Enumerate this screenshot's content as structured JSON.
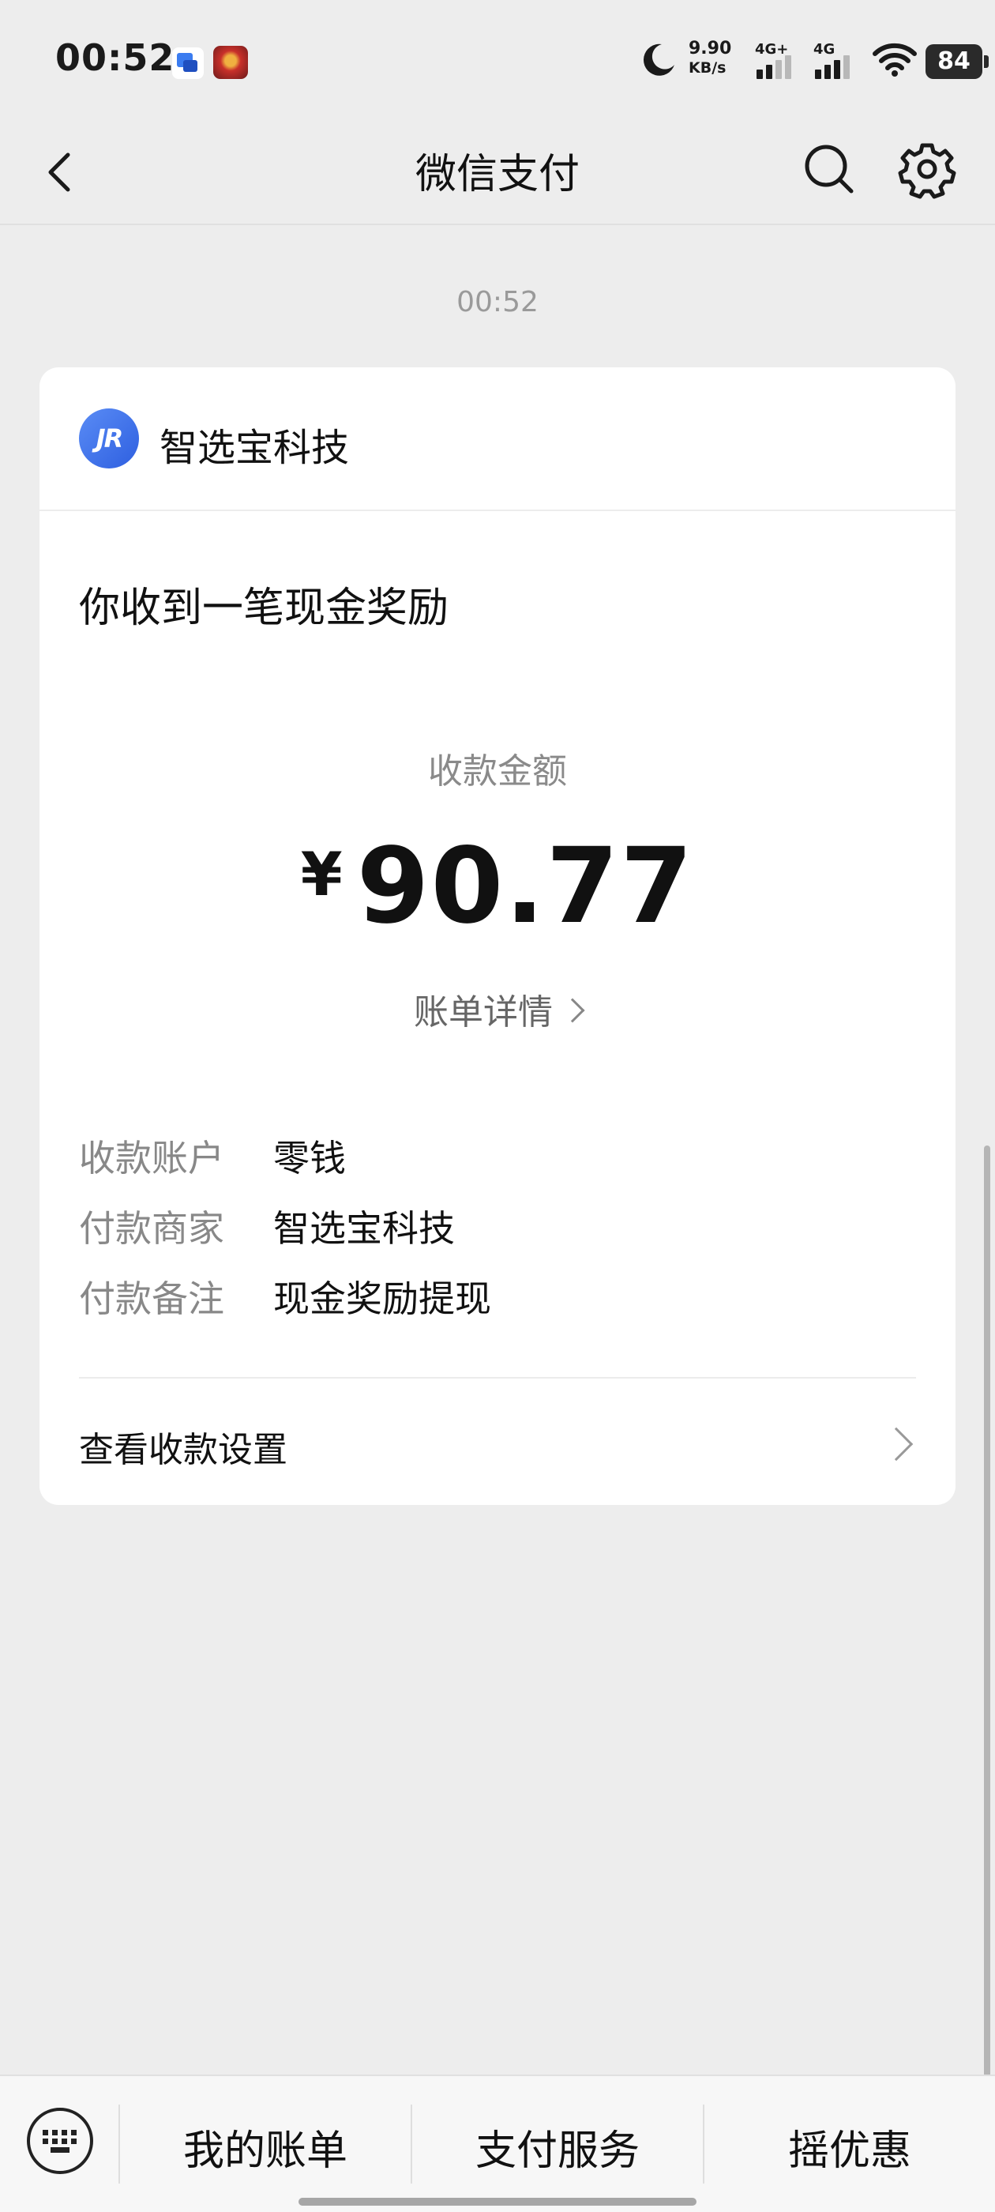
{
  "status_bar": {
    "time": "00:52",
    "net_speed_value": "9.90",
    "net_speed_unit": "KB/s",
    "signal1_label": "4G+",
    "signal2_label": "4G",
    "battery": "84"
  },
  "nav": {
    "title": "微信支付"
  },
  "message": {
    "time": "00:52"
  },
  "card": {
    "logo_text": "JR",
    "merchant": "智选宝科技",
    "headline": "你收到一笔现金奖励",
    "amount_label": "收款金额",
    "currency": "¥",
    "amount": "90.77",
    "bill_link": "账单详情",
    "rows": [
      {
        "key": "收款账户",
        "value": "零钱"
      },
      {
        "key": "付款商家",
        "value": "智选宝科技"
      },
      {
        "key": "付款备注",
        "value": "现金奖励提现"
      }
    ],
    "settings_link": "查看收款设置"
  },
  "bottom_menu": {
    "items": [
      "我的账单",
      "支付服务",
      "摇优惠"
    ]
  },
  "colors": {
    "background": "#ededed",
    "card": "#ffffff",
    "logo": "#3b6fe8"
  }
}
